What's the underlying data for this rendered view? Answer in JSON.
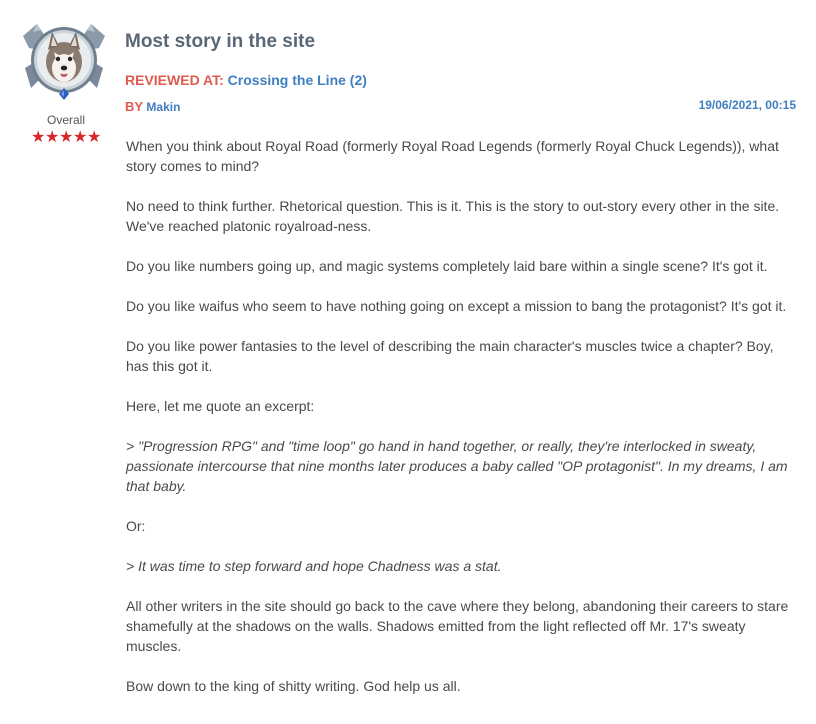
{
  "review": {
    "title": "Most story in the site",
    "reviewed_at_label": "REVIEWED AT:",
    "chapter_link": "Crossing the Line (2)",
    "by_label": "BY",
    "author": "Makin",
    "date": "19/06/2021, 00:15",
    "overall_label": "Overall",
    "rating_stars": 5,
    "paragraphs": [
      "When you think about Royal Road (formerly Royal Road Legends (formerly Royal Chuck Legends)), what story comes to mind?",
      "No need to think further. Rhetorical question. This is it. This is the story to out-story every other in the site. We've reached platonic royalroad-ness.",
      "Do you like numbers going up, and magic systems completely laid bare within a single scene? It's got it.",
      "Do you like waifus who seem to have nothing going on except a mission to bang the protagonist? It's got it.",
      "Do you like power fantasies to the level of describing the main character's muscles twice a chapter? Boy, has this got it.",
      "Here, let me quote an excerpt:",
      "> \"Progression RPG\" and \"time loop\" go hand in hand together, or really, they're interlocked in sweaty, passionate intercourse that nine months later produces a baby called \"OP protagonist\". In my dreams, I am that baby.",
      "Or:",
      "> It was time to step forward and hope Chadness was a stat.",
      "All other writers in the site should go back to the cave where they belong, abandoning their careers to stare shamefully at the shadows on the walls. Shadows emitted from the light reflected off Mr. 17's sweaty muscles.",
      "Bow down to the king of shitty writing. God help us all."
    ]
  },
  "colors": {
    "title": "#5b6777",
    "accent_red": "#e05a4f",
    "link_blue": "#3f7fbf",
    "star_red": "#d9262c",
    "body_text": "#4a4a4a"
  },
  "icons": {
    "avatar": "husky-dog-avatar-with-ornate-frame",
    "star": "star-icon"
  }
}
